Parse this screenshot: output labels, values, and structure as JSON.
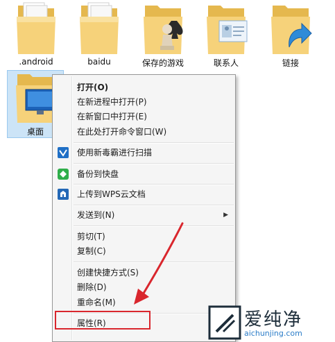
{
  "folders": [
    {
      "label": ".android",
      "icon": "documents-folder-icon"
    },
    {
      "label": "baidu",
      "icon": "documents-folder-icon"
    },
    {
      "label": "保存的游戏",
      "icon": "saved-games-folder-icon"
    },
    {
      "label": "联系人",
      "icon": "contacts-folder-icon"
    },
    {
      "label": "链接",
      "icon": "links-folder-icon"
    }
  ],
  "selected_folder": {
    "label": "桌面",
    "icon": "desktop-folder-icon"
  },
  "context_menu": {
    "open": "打开(O)",
    "open_new_process": "在新进程中打开(P)",
    "open_new_window": "在新窗口中打开(E)",
    "open_cmd_here": "在此处打开命令窗口(W)",
    "scan_virus": "使用新毒霸进行扫描",
    "backup_kuaipan": "备份到快盘",
    "upload_wps": "上传到WPS云文档",
    "send_to": "发送到(N)",
    "cut": "剪切(T)",
    "copy": "复制(C)",
    "create_shortcut": "创建快捷方式(S)",
    "delete": "删除(D)",
    "rename": "重命名(M)",
    "properties": "属性(R)"
  },
  "watermark": {
    "brand": "爱纯净",
    "url": "aichunjing.com"
  },
  "colors": {
    "highlight_red": "#d9262d",
    "folder_yellow": "#f3c966",
    "selection_blue": "#cce4f7"
  }
}
